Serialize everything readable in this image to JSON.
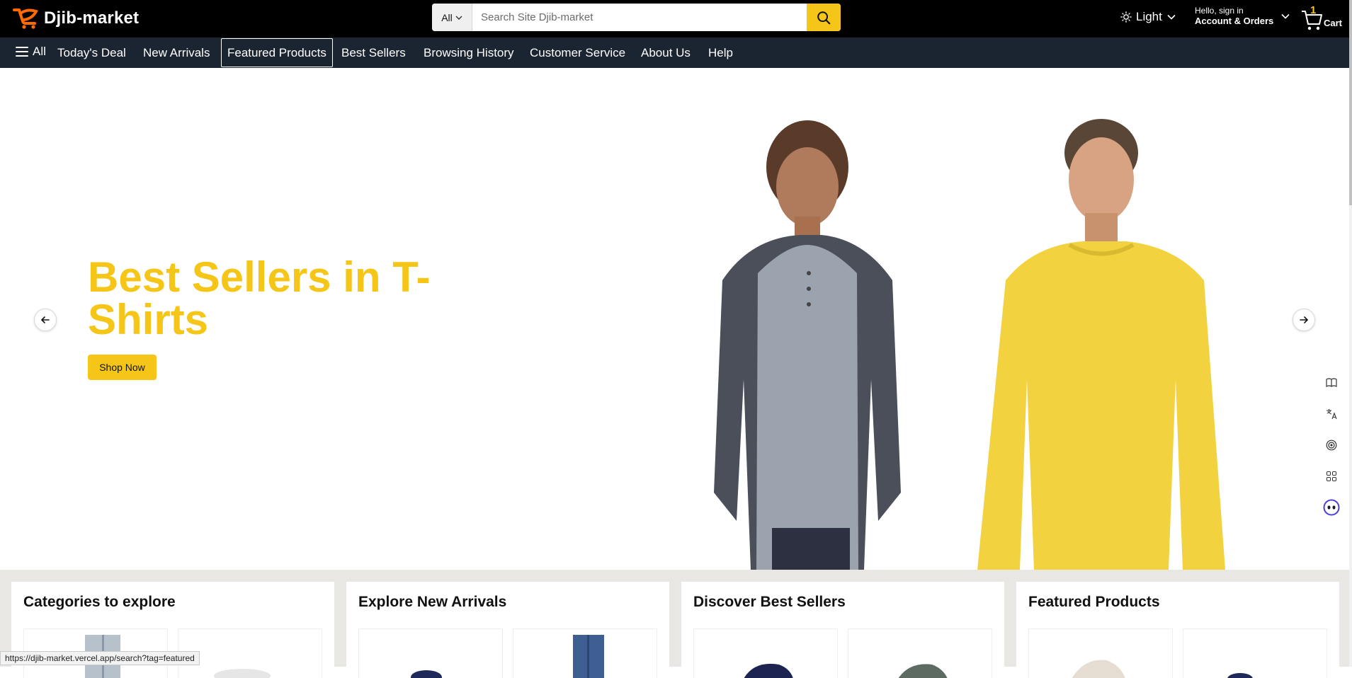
{
  "header": {
    "logo_text": "Djib-market",
    "search": {
      "category": "All",
      "placeholder": "Search Site Djib-market"
    },
    "theme_label": "Light",
    "account": {
      "greeting": "Hello, sign in",
      "label": "Account & Orders"
    },
    "cart": {
      "count": "1",
      "label": "Cart"
    }
  },
  "nav": {
    "all_label": "All",
    "items": [
      {
        "label": "Today's Deal"
      },
      {
        "label": "New Arrivals"
      },
      {
        "label": "Featured Products",
        "active": true
      },
      {
        "label": "Best Sellers"
      },
      {
        "label": "Browsing History"
      },
      {
        "label": "Customer Service"
      },
      {
        "label": "About Us"
      },
      {
        "label": "Help"
      }
    ]
  },
  "hero": {
    "title": "Best Sellers in T-Shirts",
    "cta": "Shop Now",
    "accent_color": "#f5c518"
  },
  "cards": [
    {
      "title": "Categories to explore"
    },
    {
      "title": "Explore New Arrivals"
    },
    {
      "title": "Discover Best Sellers"
    },
    {
      "title": "Featured Products"
    }
  ],
  "status_url": "https://djib-market.vercel.app/search?tag=featured",
  "icons": {
    "menu": "hamburger-icon",
    "search": "search-icon",
    "theme": "sun-icon",
    "cart": "cart-icon",
    "prev": "arrow-left-icon",
    "next": "arrow-right-icon",
    "side_tools": [
      "book-icon",
      "translate-icon",
      "broadcast-icon",
      "apps-grid-icon",
      "assistant-icon"
    ]
  }
}
